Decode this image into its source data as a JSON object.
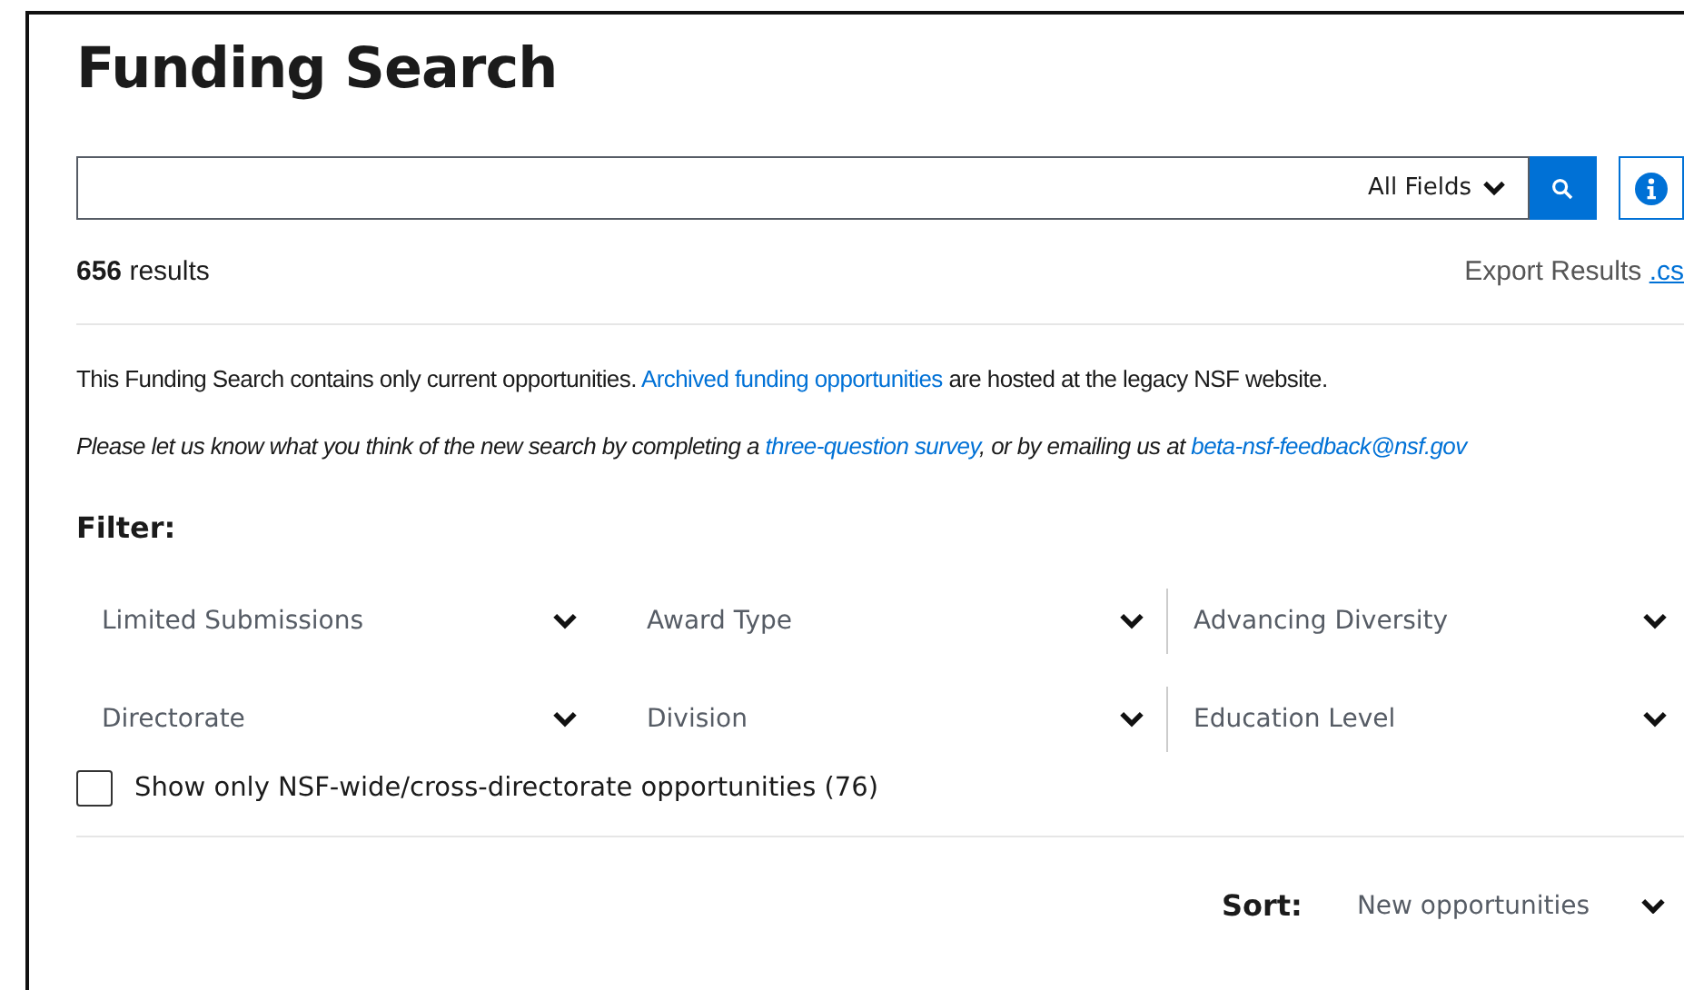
{
  "title": "Funding Search",
  "search": {
    "scope": "All Fields"
  },
  "results": {
    "count": "656",
    "label": "results",
    "export_label": "Export Results",
    "export_link": ".cs"
  },
  "notice": [
    {
      "kind": "text",
      "text": "This Funding Search contains only current opportunities. "
    },
    {
      "kind": "link",
      "text": "Archived funding opportunities"
    },
    {
      "kind": "text",
      "text": " are hosted at the legacy NSF website."
    }
  ],
  "feedback": [
    {
      "kind": "text",
      "text": "Please let us know what you think of the new search by completing a "
    },
    {
      "kind": "link",
      "text": "three-question survey"
    },
    {
      "kind": "text",
      "text": ", or by emailing us at "
    },
    {
      "kind": "link",
      "text": "beta-nsf-feedback@nsf.gov"
    }
  ],
  "filter_label": "Filter:",
  "filters": [
    {
      "label": "Limited Submissions"
    },
    {
      "label": "Award Type"
    },
    {
      "label": "Advancing Diversity"
    },
    {
      "label": "Directorate"
    },
    {
      "label": "Division"
    },
    {
      "label": "Education Level"
    }
  ],
  "checkbox": {
    "label": "Show only NSF-wide/cross-directorate opportunities",
    "count": "(76)",
    "checked": false
  },
  "sort": {
    "label": "Sort:",
    "value": "New opportunities"
  }
}
